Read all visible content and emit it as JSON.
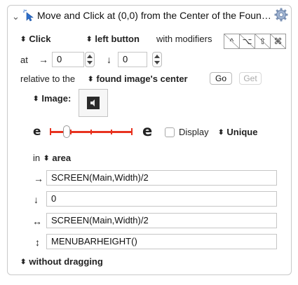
{
  "header": {
    "title": "Move and Click at (0,0) from the Center of the Foun…",
    "disclosure": "⌄"
  },
  "click_row": {
    "action": "Click",
    "button": "left button",
    "with_modifiers": "with modifiers",
    "modifiers": [
      "^",
      "⌥",
      "⇧",
      "⌘"
    ]
  },
  "at_row": {
    "label": "at",
    "x_arrow": "→",
    "x_value": "0",
    "y_arrow": "↓",
    "y_value": "0"
  },
  "relative_row": {
    "label": "relative to the",
    "target": "found image's center",
    "go": "Go",
    "get": "Get"
  },
  "image_row": {
    "label": "Image:"
  },
  "fuzz_row": {
    "small_e": "e",
    "large_e": "e",
    "display_label": "Display",
    "display_checked": false,
    "unique": "Unique",
    "slider_fraction": 0.12
  },
  "area": {
    "in_label": "in",
    "area_label": "area",
    "rows": [
      {
        "symbol": "→",
        "value": "SCREEN(Main,Width)/2"
      },
      {
        "symbol": "↓",
        "value": "0"
      },
      {
        "symbol": "↔",
        "value": "SCREEN(Main,Width)/2"
      },
      {
        "symbol": "↕",
        "value": "MENUBARHEIGHT()"
      }
    ]
  },
  "dragging": "without dragging",
  "colors": {
    "slider_red": "#e8321f",
    "icon_blue": "#2c6ecb"
  }
}
